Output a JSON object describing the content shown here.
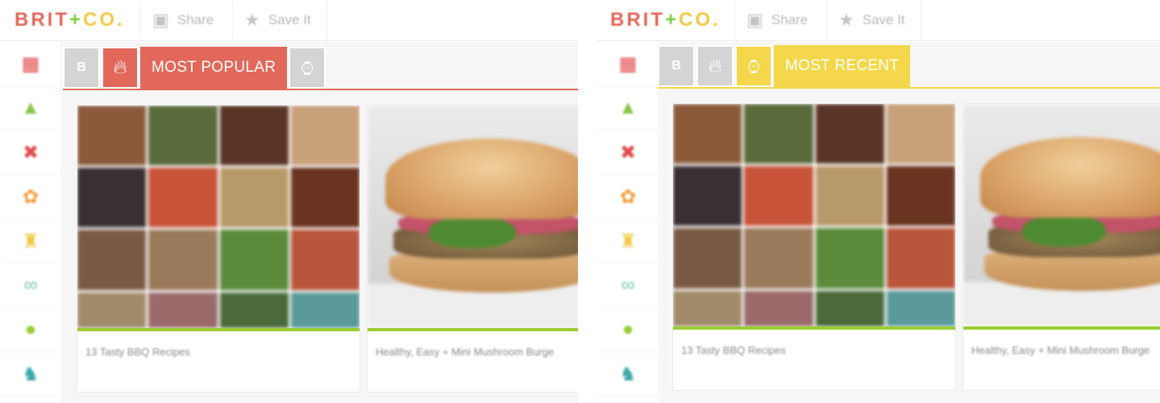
{
  "header": {
    "logo_brit": "BRIT",
    "logo_plus": "+",
    "logo_co": "CO.",
    "share_label": "Share",
    "save_label": "Save It",
    "share_icon": "share-icon",
    "save_icon": "star-icon"
  },
  "sidebar": {
    "items": [
      {
        "icon": "calendar-icon",
        "glyph": "▦",
        "color": "#e24b4b"
      },
      {
        "icon": "tree-icon",
        "glyph": "▲",
        "color": "#8bc34a"
      },
      {
        "icon": "cross-icon",
        "glyph": "✖",
        "color": "#e24b4b"
      },
      {
        "icon": "paw-icon",
        "glyph": "✿",
        "color": "#f39c3a"
      },
      {
        "icon": "dress-icon",
        "glyph": "♜",
        "color": "#f2c744"
      },
      {
        "icon": "mustache-icon",
        "glyph": "∞",
        "color": "#7ac7a8"
      },
      {
        "icon": "bowl-icon",
        "glyph": "●",
        "color": "#9acd32"
      },
      {
        "icon": "owl-icon",
        "glyph": "♞",
        "color": "#3aa6a6"
      }
    ]
  },
  "tabs": {
    "b_label": "B",
    "popular_label": "MOST POPULAR",
    "recent_label": "MOST RECENT",
    "popular_color": "#e2685a",
    "recent_color": "#f4d74a"
  },
  "cards": {
    "card1_title": "13 Tasty BBQ Recipes",
    "card2_title": "Healthy, Easy + Mini Mushroom Burge"
  }
}
